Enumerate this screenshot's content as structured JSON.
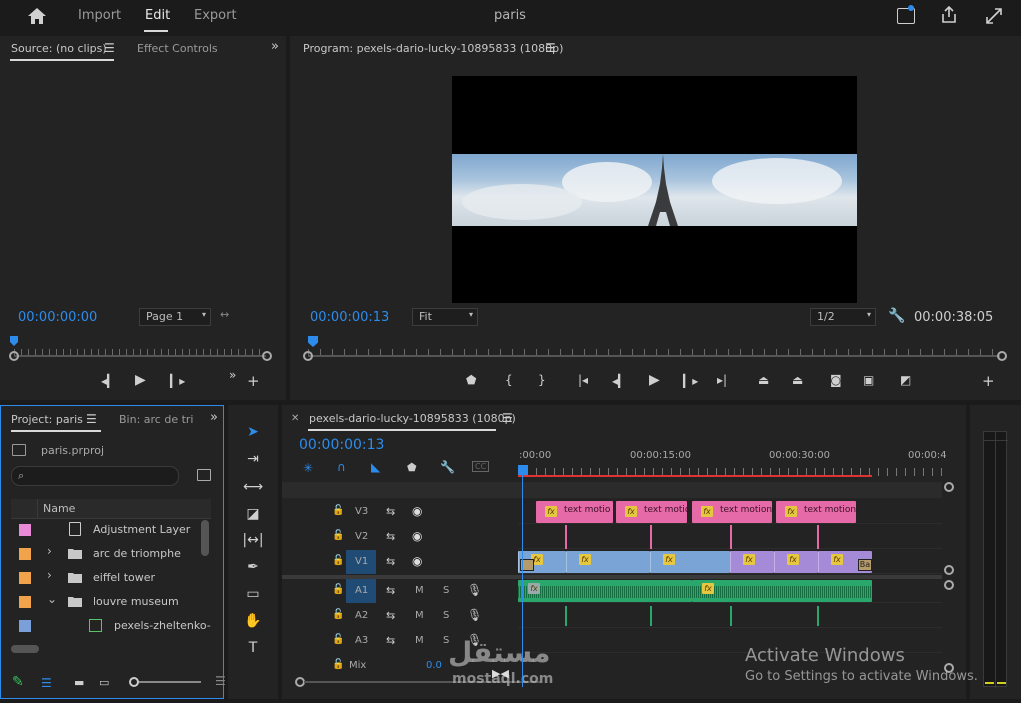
{
  "topbar": {
    "home_icon": "home-icon",
    "import_label": "Import",
    "edit_label": "Edit",
    "export_label": "Export",
    "project_title": "paris"
  },
  "source": {
    "tab_label": "Source: (no clips)",
    "effect_controls_label": "Effect Controls",
    "timecode": "00:00:00:00",
    "page_select": "Page 1"
  },
  "program": {
    "title": "Program: pexels-dario-lucky-10895833 (1080p)",
    "timecode": "00:00:00:13",
    "fit_select": "Fit",
    "res_select": "1/2",
    "duration": "00:00:38:05"
  },
  "project": {
    "tab_label": "Project: paris",
    "bin_tab_label": "Bin: arc de tri",
    "file_name": "paris.prproj",
    "search_placeholder": "",
    "col_name": "Name",
    "items": [
      {
        "label": "Adjustment Layer",
        "color": "#e88ad6",
        "type": "adjustment"
      },
      {
        "label": "arc de triomphe",
        "color": "#f0a34a",
        "type": "folder"
      },
      {
        "label": "eiffel tower",
        "color": "#f0a34a",
        "type": "folder"
      },
      {
        "label": "louvre museum",
        "color": "#f0a34a",
        "type": "folder-open"
      },
      {
        "label": "pexels-zheltenko-",
        "color": "#7b9fd8",
        "type": "sequence"
      }
    ]
  },
  "timeline": {
    "tab_label": "pexels-dario-lucky-10895833 (1080p)",
    "timecode": "00:00:00:13",
    "ruler": [
      ":00:00",
      "00:00:15:00",
      "00:00:30:00",
      "00:00:4"
    ],
    "tracks_video": [
      "V3",
      "V2",
      "V1"
    ],
    "tracks_audio": [
      "A1",
      "A2",
      "A3"
    ],
    "mute": "M",
    "solo": "S",
    "mix_label": "Mix",
    "mix_value": "0.0",
    "v3_clips": [
      "text motio",
      "text motio",
      "text motion/",
      "text motion/"
    ],
    "v1_end_badge": "Ba",
    "fx_label": "fx"
  },
  "overlay": {
    "activate_title": "Activate Windows",
    "activate_sub": "Go to Settings to activate Windows.",
    "watermark": "مستقل",
    "watermark_sub": "mostaql.com"
  },
  "colors": {
    "accent_blue": "#2d8ceb",
    "clip_pink": "#e66aa8",
    "clip_blue": "#7aa4d6",
    "clip_purple": "#a58ad8",
    "audio_green": "#2aa86b"
  }
}
